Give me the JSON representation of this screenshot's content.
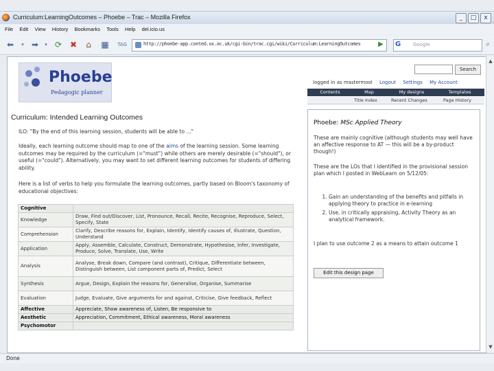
{
  "window": {
    "title": "Curriculum:LearningOutcomes – Phoebe – Trac – Mozilla Firefox",
    "min": "_",
    "max": "□",
    "close": "x"
  },
  "menu": [
    "File",
    "Edit",
    "View",
    "History",
    "Bookmarks",
    "Tools",
    "Help",
    "del.icio.us"
  ],
  "nav": {
    "url": "http://phoebe-app.conted.ox.ac.uk/cgi-bin/trac.cgi/wiki/Curriculum:LearningOutcomes",
    "search_placeholder": "Google"
  },
  "site": {
    "logo_word": "Phoebe",
    "logo_tag": "Pedagogic planner",
    "user_text": "logged in as mastermool",
    "logout": "Logout",
    "settings": "Settings",
    "account": "My Account",
    "search_btn": "Search"
  },
  "mainnav": [
    "Contents",
    "Map",
    "My designs",
    "Templates"
  ],
  "subnav": [
    "Title Index",
    "Recent Changes",
    "Page History"
  ],
  "page": {
    "title": "Curriculum: Intended Learning Outcomes",
    "p1": "ILO: \"By the end of this learning session, students will be able to ...\"",
    "p2_a": "Ideally, each learning outcome should map to one of the ",
    "p2_link": "aims",
    "p2_b": " of the learning session. Some learning outcomes may be required by the curriculum (=\"must\") while others are merely desirable (=\"should\"), or useful (=\"could\"). Alternatively, you may want to set different learning outcomes for students of differing ability.",
    "p3": "Here is a list of verbs to help you formulate the learning outcomes, partly based on Bloom's taxonomy of educational objectives:"
  },
  "verbs": {
    "header": "Cognitive",
    "rows": [
      {
        "cat": "Knowledge",
        "verbs": "Draw, Find out/Discover, List, Pronounce, Recall, Recite, Recognise, Reproduce, Select, Specify, State"
      },
      {
        "cat": "Comprehension",
        "verbs": "Clarify, Describe reasons for, Explain, Identify, Identify causes of, Illustrate, Question, Understand"
      },
      {
        "cat": "Application",
        "verbs": "Apply, Assemble, Calculate, Construct, Demonstrate, Hypothesise, Infer, Investigate, Produce, Solve, Translate, Use, Write"
      },
      {
        "cat": "Analysis",
        "verbs": "Analyse, Break down, Compare (and contrast), Critique, Differentiate between, Distinguish between, List component parts of, Predict, Select"
      },
      {
        "cat": "Synthesis",
        "verbs": "Argue, Design, Explain the reasons for, Generalise, Organise, Summarise"
      },
      {
        "cat": "Evaluation",
        "verbs": "Judge, Evaluate, Give arguments for and against, Criticise, Give feedback, Reflect"
      }
    ],
    "extra": [
      {
        "cat": "Affective",
        "verbs": "Appreciate, Show awareness of, Listen, Be responsive to"
      },
      {
        "cat": "Aesthetic",
        "verbs": "Appreciation, Commitment, Ethical awareness, Moral awareness"
      },
      {
        "cat": "Psychomotor",
        "verbs": ""
      }
    ]
  },
  "sidebar": {
    "title_prefix": "Phoebe: ",
    "title_name": "MSc Applied Theory",
    "p1": "These are mainly cognitive (although students may well have an affective response to AT — this will be a by-product though!)",
    "p2": "These are the LOs that I identified in the provisional session plan which I posted in WebLearn on 5/12/05:",
    "items": [
      "Gain an understanding of the benefits and pitfalls in applying theory to practice in e-learning",
      "Use, in critically appraising, Activity Theory as an analytical framework."
    ],
    "p3": "I plan to use outcome 2 as a means to attain outcome 1",
    "edit_btn": "Edit this design page"
  },
  "status": "Done"
}
